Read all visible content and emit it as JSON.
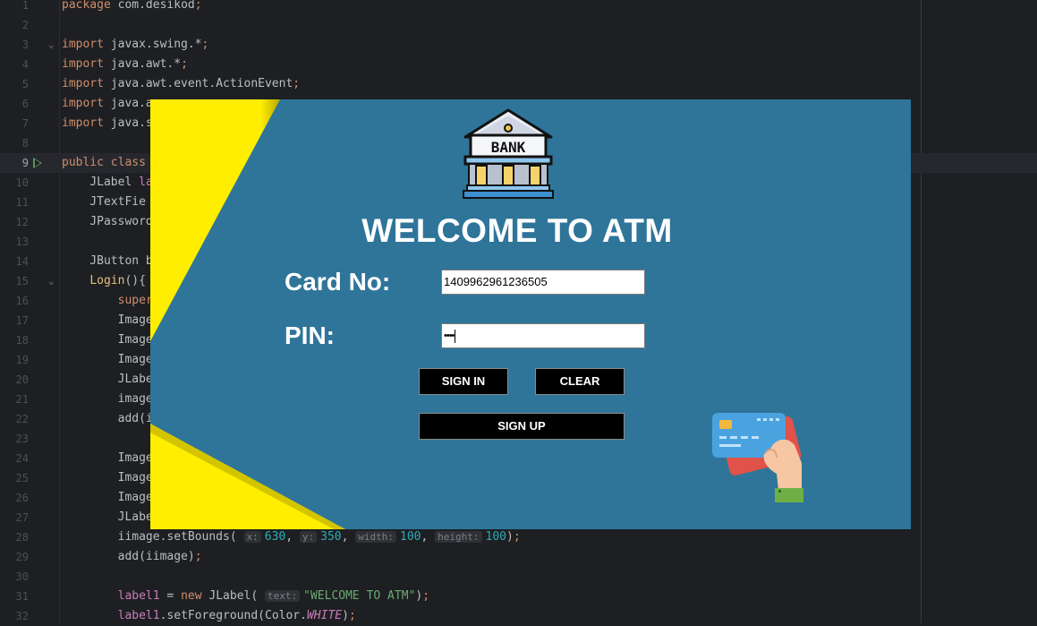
{
  "editor": {
    "current_line": 9,
    "lines": [
      {
        "n": "1",
        "code": "<span class=\"kw\">package</span> com.desikod<span class=\"kw\">;</span>"
      },
      {
        "n": "2",
        "code": ""
      },
      {
        "n": "3",
        "code": "<span class=\"kw\">import</span> javax.swing.*<span class=\"kw\">;</span>",
        "fold": true
      },
      {
        "n": "4",
        "code": "<span class=\"kw\">import</span> java.awt.*<span class=\"kw\">;</span>"
      },
      {
        "n": "5",
        "code": "<span class=\"kw\">import</span> java.awt.event.ActionEvent<span class=\"kw\">;</span>"
      },
      {
        "n": "6",
        "code": "<span class=\"kw\">import</span> java.a"
      },
      {
        "n": "7",
        "code": "<span class=\"kw\">import</span> java.s"
      },
      {
        "n": "8",
        "code": ""
      },
      {
        "n": "9",
        "code": "<span class=\"kw\">public class</span>",
        "run": true
      },
      {
        "n": "10",
        "code": "    JLabel <span class=\"sf\" style=\"font-style:normal;color:#c77dbb\">la</span>"
      },
      {
        "n": "11",
        "code": "    JTextFie"
      },
      {
        "n": "12",
        "code": "    JPassword"
      },
      {
        "n": "13",
        "code": ""
      },
      {
        "n": "14",
        "code": "    JButton b"
      },
      {
        "n": "15",
        "code": "    <span style=\"color:#e6c07b\">Login</span>(){",
        "fold": true
      },
      {
        "n": "16",
        "code": "        <span class=\"kw\">super</span>"
      },
      {
        "n": "17",
        "code": "        Image"
      },
      {
        "n": "18",
        "code": "        Image"
      },
      {
        "n": "19",
        "code": "        Image"
      },
      {
        "n": "20",
        "code": "        JLabe"
      },
      {
        "n": "21",
        "code": "        image"
      },
      {
        "n": "22",
        "code": "        add(i"
      },
      {
        "n": "23",
        "code": ""
      },
      {
        "n": "24",
        "code": "        Image"
      },
      {
        "n": "25",
        "code": "        Image"
      },
      {
        "n": "26",
        "code": "        Image"
      },
      {
        "n": "27",
        "code": "        JLabe"
      },
      {
        "n": "28",
        "code": "        iimage.setBounds( <span class=\"hint\">x:</span><span class=\"num\">630</span>, <span class=\"hint\">y:</span><span class=\"num\">350</span>, <span class=\"hint\">width:</span><span class=\"num\">100</span>, <span class=\"hint\">height:</span><span class=\"num\">100</span>)<span class=\"kw\">;</span>"
      },
      {
        "n": "29",
        "code": "        add(iimage)<span class=\"kw\">;</span>"
      },
      {
        "n": "30",
        "code": ""
      },
      {
        "n": "31",
        "code": "        <span class=\"sf\" style=\"font-style:normal;color:#c77dbb\">label1</span> = <span class=\"kw\">new</span> JLabel( <span class=\"hint\">text:</span><span class=\"str\">\"WELCOME TO ATM\"</span>)<span class=\"kw\">;</span>"
      },
      {
        "n": "32",
        "code": "        <span class=\"sf\" style=\"font-style:normal;color:#c77dbb\">label1</span>.setForeground(Color.<span class=\"sf\">WHITE</span>)<span class=\"kw\">;</span>"
      }
    ]
  },
  "login": {
    "title": "WELCOME TO ATM",
    "bank_sign": "BANK",
    "card_label": "Card No:",
    "card_value": "1409962961236505",
    "pin_label": "PIN:",
    "pin_value": "••••",
    "sign_in_label": "SIGN IN",
    "clear_label": "CLEAR",
    "sign_up_label": "SIGN UP"
  },
  "colors": {
    "window_bg": "#2e7599",
    "accent_yellow": "#ffee00",
    "button_bg": "#000000"
  },
  "icons": [
    "bank-icon",
    "card-hand-icon",
    "run-icon",
    "fold-icon"
  ]
}
